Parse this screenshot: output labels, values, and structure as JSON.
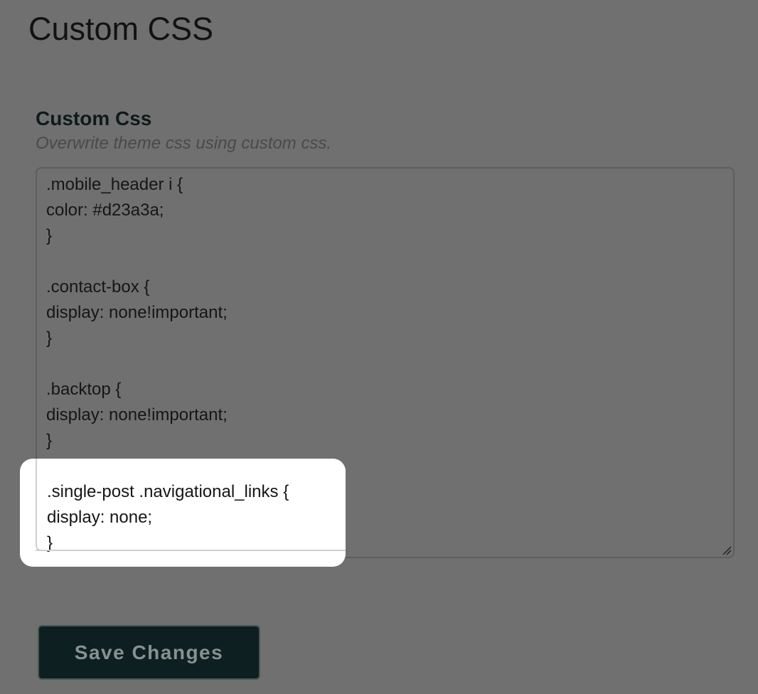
{
  "page": {
    "title": "Custom CSS"
  },
  "section": {
    "title": "Custom Css",
    "description": "Overwrite theme css using custom css."
  },
  "editor": {
    "value": ".mobile_header i {\ncolor: #d23a3a;\n}\n\n.contact-box {\ndisplay: none!important;\n}\n\n.backtop {\ndisplay: none!important;\n}",
    "highlighted_value": ".single-post .navigational_links {\ndisplay: none;\n}",
    "resize_icon": "resize-handle-icon"
  },
  "actions": {
    "save_label": "Save Changes"
  },
  "colors": {
    "background": "#707070",
    "button_bg": "#0d1f20",
    "highlight_bg": "#ffffff"
  }
}
